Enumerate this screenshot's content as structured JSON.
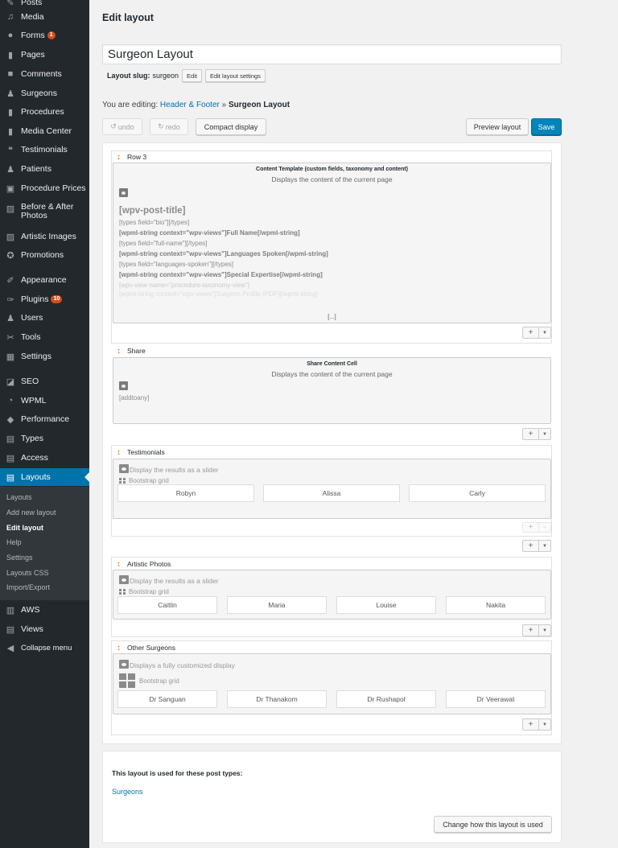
{
  "sidebar": {
    "items": [
      {
        "label": "Posts",
        "icon": "pin-icon"
      },
      {
        "label": "Media",
        "icon": "media-icon"
      },
      {
        "label": "Forms",
        "icon": "forms-icon",
        "badge": "1"
      },
      {
        "label": "Pages",
        "icon": "page-icon"
      },
      {
        "label": "Comments",
        "icon": "comment-icon"
      },
      {
        "label": "Surgeons",
        "icon": "user-icon"
      },
      {
        "label": "Procedures",
        "icon": "page-icon"
      },
      {
        "label": "Media Center",
        "icon": "page-icon"
      },
      {
        "label": "Testimonials",
        "icon": "quote-icon"
      },
      {
        "label": "Patients",
        "icon": "user-icon"
      },
      {
        "label": "Procedure Prices",
        "icon": "briefcase-icon"
      },
      {
        "label": "Before & After Photos",
        "icon": "gallery-icon"
      },
      {
        "label": "Artistic Images",
        "icon": "gallery-icon"
      },
      {
        "label": "Promotions",
        "icon": "award-icon"
      },
      {
        "label": "Appearance",
        "icon": "brush-icon"
      },
      {
        "label": "Plugins",
        "icon": "plugin-icon",
        "badge": "10"
      },
      {
        "label": "Users",
        "icon": "user-icon"
      },
      {
        "label": "Tools",
        "icon": "wrench-icon"
      },
      {
        "label": "Settings",
        "icon": "settings-icon"
      },
      {
        "label": "SEO",
        "icon": "seo-icon"
      },
      {
        "label": "WPML",
        "icon": "wpml-icon"
      },
      {
        "label": "Performance",
        "icon": "performance-icon"
      },
      {
        "label": "Types",
        "icon": "toolset-icon"
      },
      {
        "label": "Access",
        "icon": "toolset-icon"
      },
      {
        "label": "Layouts",
        "icon": "toolset-icon"
      },
      {
        "label": "AWS",
        "icon": "aws-icon"
      },
      {
        "label": "Views",
        "icon": "toolset-icon"
      },
      {
        "label": "Collapse menu",
        "icon": "collapse-icon"
      }
    ],
    "submenu": [
      "Layouts",
      "Add new layout",
      "Edit layout",
      "Help",
      "Settings",
      "Layouts CSS",
      "Import/Export"
    ],
    "active_color": "#0073aa"
  },
  "header": {
    "page_title": "Edit layout",
    "layout_name": "Surgeon Layout",
    "slug_label": "Layout slug:",
    "slug_value": "surgeon",
    "edit_button": "Edit",
    "settings_button": "Edit layout settings",
    "editing_prefix": "You are editing:",
    "editing_parent": "Header & Footer",
    "editing_sep": "»",
    "editing_current": "Surgeon Layout"
  },
  "toolbar": {
    "undo": "undo",
    "redo": "redo",
    "compact": "Compact display",
    "preview": "Preview layout",
    "save": "Save"
  },
  "rows": {
    "row3": {
      "label": "Row 3",
      "cell_title": "Content Template (custom fields, taxonomy and content)",
      "cell_sub": "Displays the content of the current page",
      "post_title": "[wpv-post-title]",
      "lines": [
        " [types field=\"bio\"][/types]",
        "[wpml-string context=\"wpv-views\"]Full Name[/wpml-string]",
        "[types field=\"full-name\"][/types]",
        "[wpml-string context=\"wpv-views\"]Languages Spoken[/wpml-string]",
        "[types field=\"languages-spoken\"][/types]",
        "[wpml-string context=\"wpv-views\"]Special Expertise[/wpml-string]",
        "[wpv-view name=\"procedure-taxonomy-view\"]",
        "[wpml-string context=\"wpv-views\"]Surgeon Profile (PDF)[/wpml-string]"
      ],
      "ellipsis": "[...]"
    },
    "share": {
      "label": "Share",
      "cell_title": "Share Content Cell",
      "cell_sub": "Displays the content of the current page",
      "content": "[addtoany]"
    },
    "testimonials": {
      "label": "Testimonials",
      "view_text": "Display the results as a slider",
      "grid_text": "Bootstrap grid",
      "names": [
        "Robyn",
        "Alissa",
        "Carly"
      ]
    },
    "artistic": {
      "label": "Artistic Photos",
      "view_text": "Display the results as a slider",
      "grid_text": "Bootstrap grid",
      "names": [
        "Caitlin",
        "Maria",
        "Louise",
        "Nakita"
      ]
    },
    "other": {
      "label": "Other Surgeons",
      "view_text": "Displays a fully customized display",
      "grid_text": "Bootstrap grid",
      "names": [
        "Dr Sanguan",
        "Dr Thanakom",
        "Dr Rushapol",
        "Dr Veerawat"
      ]
    }
  },
  "post_types": {
    "title": "This layout is used for these post types:",
    "link": "Surgeons",
    "button": "Change how this layout is used"
  }
}
